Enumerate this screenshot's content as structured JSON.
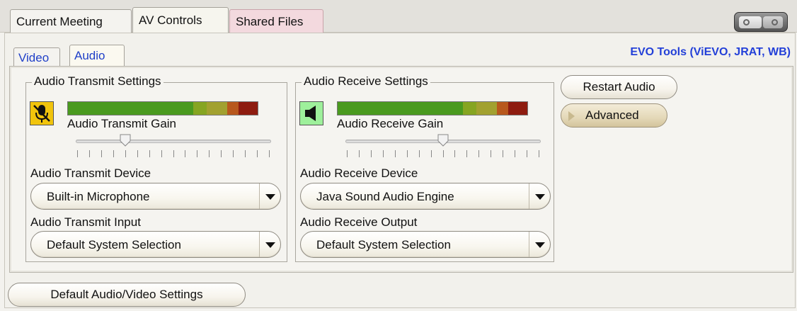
{
  "top_tabs": [
    {
      "label": "Current Meeting"
    },
    {
      "label": "AV Controls"
    },
    {
      "label": "Shared Files"
    }
  ],
  "sub_tabs": [
    {
      "label": "Video"
    },
    {
      "label": "Audio"
    }
  ],
  "evo_tools_link": "EVO Tools (ViEVO, JRAT, WB)",
  "transmit": {
    "group_title": "Audio Transmit Settings",
    "gain_label": "Audio Transmit Gain",
    "gain_level": 0.25,
    "device_label": "Audio Transmit Device",
    "device_value": "Built-in Microphone",
    "input_label": "Audio Transmit Input",
    "input_value": "Default System Selection",
    "icon": "microphone-muted-icon"
  },
  "receive": {
    "group_title": "Audio Receive Settings",
    "gain_label": "Audio Receive Gain",
    "gain_level": 0.5,
    "device_label": "Audio Receive Device",
    "device_value": "Java Sound Audio Engine",
    "output_label": "Audio Receive Output",
    "output_value": "Default System Selection",
    "icon": "speaker-icon"
  },
  "buttons": {
    "restart_audio": "Restart Audio",
    "advanced": "Advanced",
    "default_av_settings": "Default Audio/Video Settings"
  },
  "colors": {
    "meter_green": "#4a9a1f",
    "meter_olive": "#a2a130",
    "meter_orange": "#b8581d",
    "meter_red": "#8e1c10",
    "mic_bg": "#f1c40c",
    "speaker_bg": "#9ef09b",
    "link_blue": "#2340d8"
  }
}
